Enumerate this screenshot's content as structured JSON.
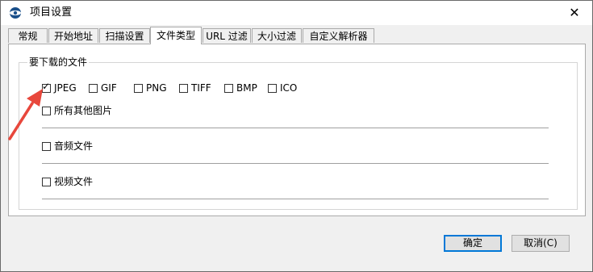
{
  "window": {
    "title": "项目设置",
    "close_glyph": "✕"
  },
  "tabs": [
    {
      "label": "常规",
      "active": false
    },
    {
      "label": "开始地址",
      "active": false
    },
    {
      "label": "扫描设置",
      "active": false
    },
    {
      "label": "文件类型",
      "active": true
    },
    {
      "label": "URL 过滤",
      "active": false
    },
    {
      "label": "大小过滤",
      "active": false
    },
    {
      "label": "自定义解析器",
      "active": false
    }
  ],
  "group": {
    "title": "要下载的文件",
    "image_types": [
      {
        "label": "JPEG",
        "checked": true
      },
      {
        "label": "GIF",
        "checked": false
      },
      {
        "label": "PNG",
        "checked": false
      },
      {
        "label": "TIFF",
        "checked": false
      },
      {
        "label": "BMP",
        "checked": false
      },
      {
        "label": "ICO",
        "checked": false
      }
    ],
    "other_images": {
      "label": "所有其他图片",
      "checked": false
    },
    "audio": {
      "label": "音频文件",
      "checked": false
    },
    "video": {
      "label": "视频文件",
      "checked": false
    }
  },
  "buttons": {
    "ok": "确定",
    "cancel": "取消(C)"
  },
  "colors": {
    "annotation_arrow": "#e8473c",
    "default_button_border": "#0078d7"
  }
}
